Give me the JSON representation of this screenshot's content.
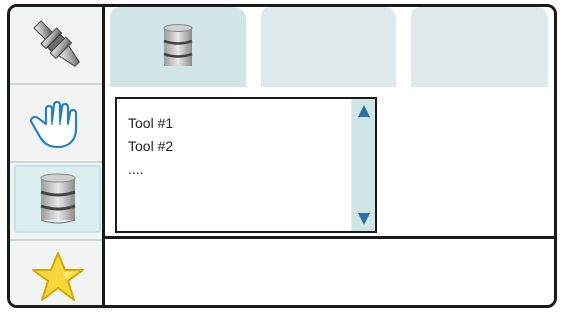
{
  "sidebar": {
    "items": [
      {
        "name": "tool-holder",
        "icon": "tool-holder-icon",
        "selected": false
      },
      {
        "name": "pointer-hand",
        "icon": "hand-pointer-icon",
        "selected": false
      },
      {
        "name": "database",
        "icon": "database-icon",
        "selected": true
      },
      {
        "name": "favorites",
        "icon": "star-icon",
        "selected": false
      }
    ]
  },
  "tabs": [
    {
      "icon": "database-icon",
      "label": ""
    },
    {
      "icon": "",
      "label": ""
    },
    {
      "icon": "",
      "label": ""
    }
  ],
  "tool_list": {
    "items": [
      "Tool #1",
      "Tool #2",
      "...."
    ]
  },
  "colors": {
    "border": "#1a1a1a",
    "sidebar_bg": "#f2f4f4",
    "tab_bg": "#dde9ea",
    "selected_bg": "#dbeff0",
    "scroll_arrow": "#2a6fa0",
    "star_fill": "#f7d83a"
  }
}
